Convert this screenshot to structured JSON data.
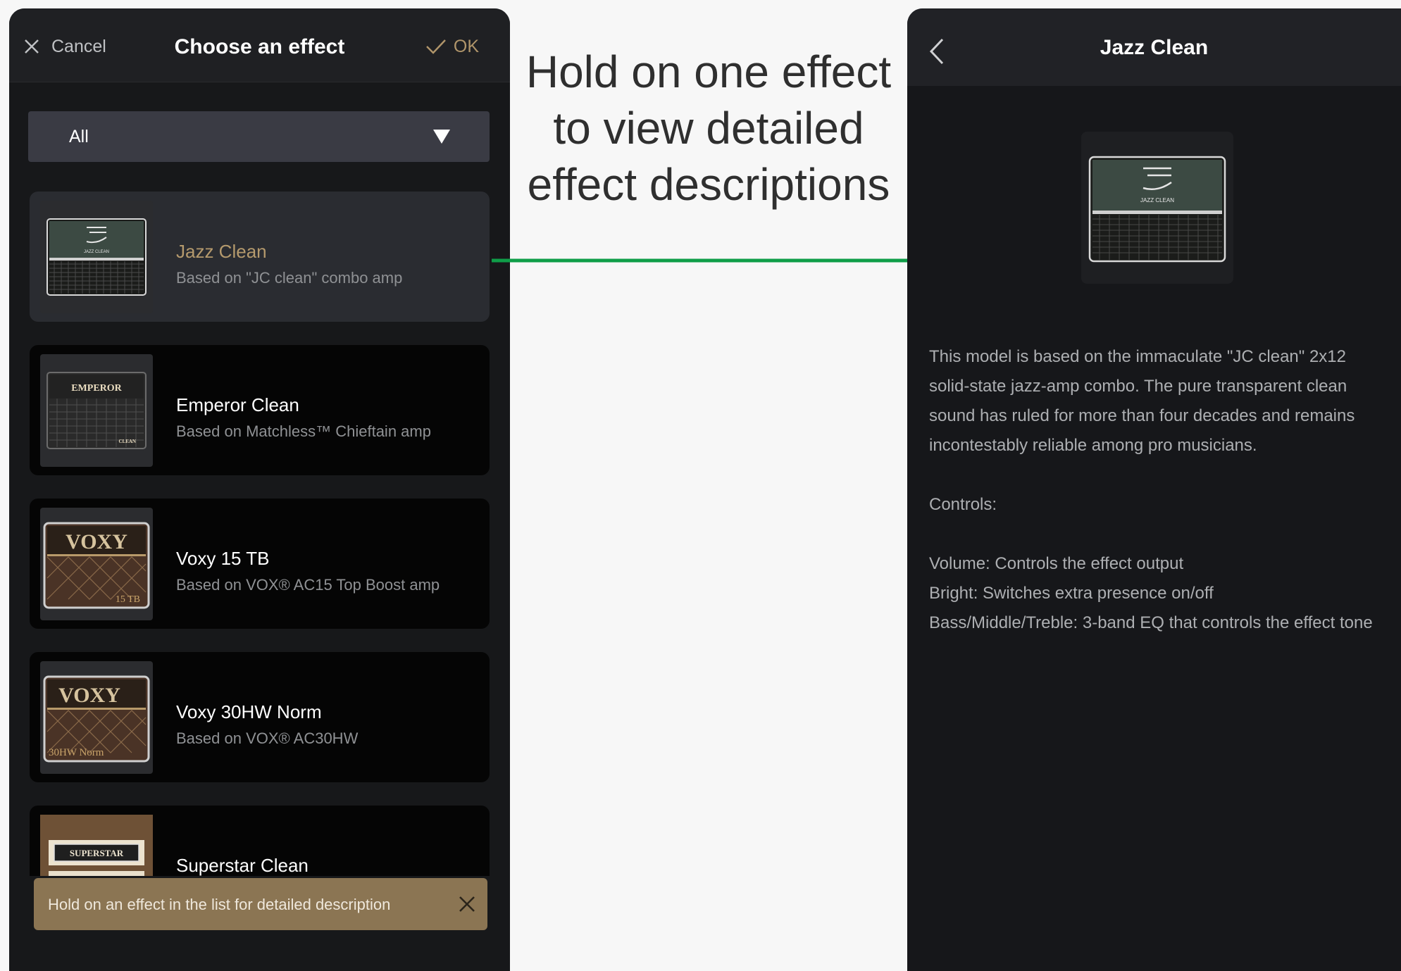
{
  "left_screen": {
    "header": {
      "cancel_label": "Cancel",
      "title": "Choose an effect",
      "ok_label": "OK"
    },
    "filter": {
      "selected": "All"
    },
    "effects": [
      {
        "name": "Jazz Clean",
        "description": "Based on \"JC clean\" combo amp",
        "selected": true,
        "thumbnail_text": "JAZZ CLEAN"
      },
      {
        "name": "Emperor Clean",
        "description": "Based on Matchless™ Chieftain amp",
        "selected": false,
        "thumbnail_text": "EMPEROR",
        "thumbnail_subtext": "CLEAN"
      },
      {
        "name": "Voxy 15 TB",
        "description": "Based on VOX® AC15 Top Boost amp",
        "selected": false,
        "thumbnail_text": "VOXY",
        "thumbnail_subtext": "15 TB"
      },
      {
        "name": "Voxy 30HW Norm",
        "description": "Based on VOX® AC30HW",
        "selected": false,
        "thumbnail_text": "VOXY",
        "thumbnail_subtext": "30HW Norm"
      },
      {
        "name": "Superstar Clean",
        "description": "",
        "selected": false,
        "thumbnail_text": "SUPERSTAR"
      }
    ],
    "toast": {
      "message": "Hold on an effect in the list for detailed description"
    }
  },
  "annotation": {
    "lines": [
      "Hold on one effect",
      "to view detailed",
      "effect descriptions"
    ],
    "arrow_color": "#0f9d48"
  },
  "right_screen": {
    "header": {
      "title": "Jazz Clean"
    },
    "thumbnail_text": "JAZZ CLEAN",
    "description": "This model is based on the immaculate \"JC clean\" 2x12 solid-state jazz-amp combo. The pure transparent clean sound has ruled for more than four decades and remains incontestably reliable among pro musicians.",
    "controls_heading": "Controls:",
    "controls": [
      "Volume: Controls the effect output",
      "Bright: Switches extra presence on/off",
      "Bass/Middle/Treble: 3-band EQ that controls the effect tone"
    ]
  },
  "colors": {
    "accent_gold": "#b59a6d",
    "toast_bg": "#8b7553",
    "panel_bg": "#17181a",
    "page_bg": "#f7f7f7"
  }
}
